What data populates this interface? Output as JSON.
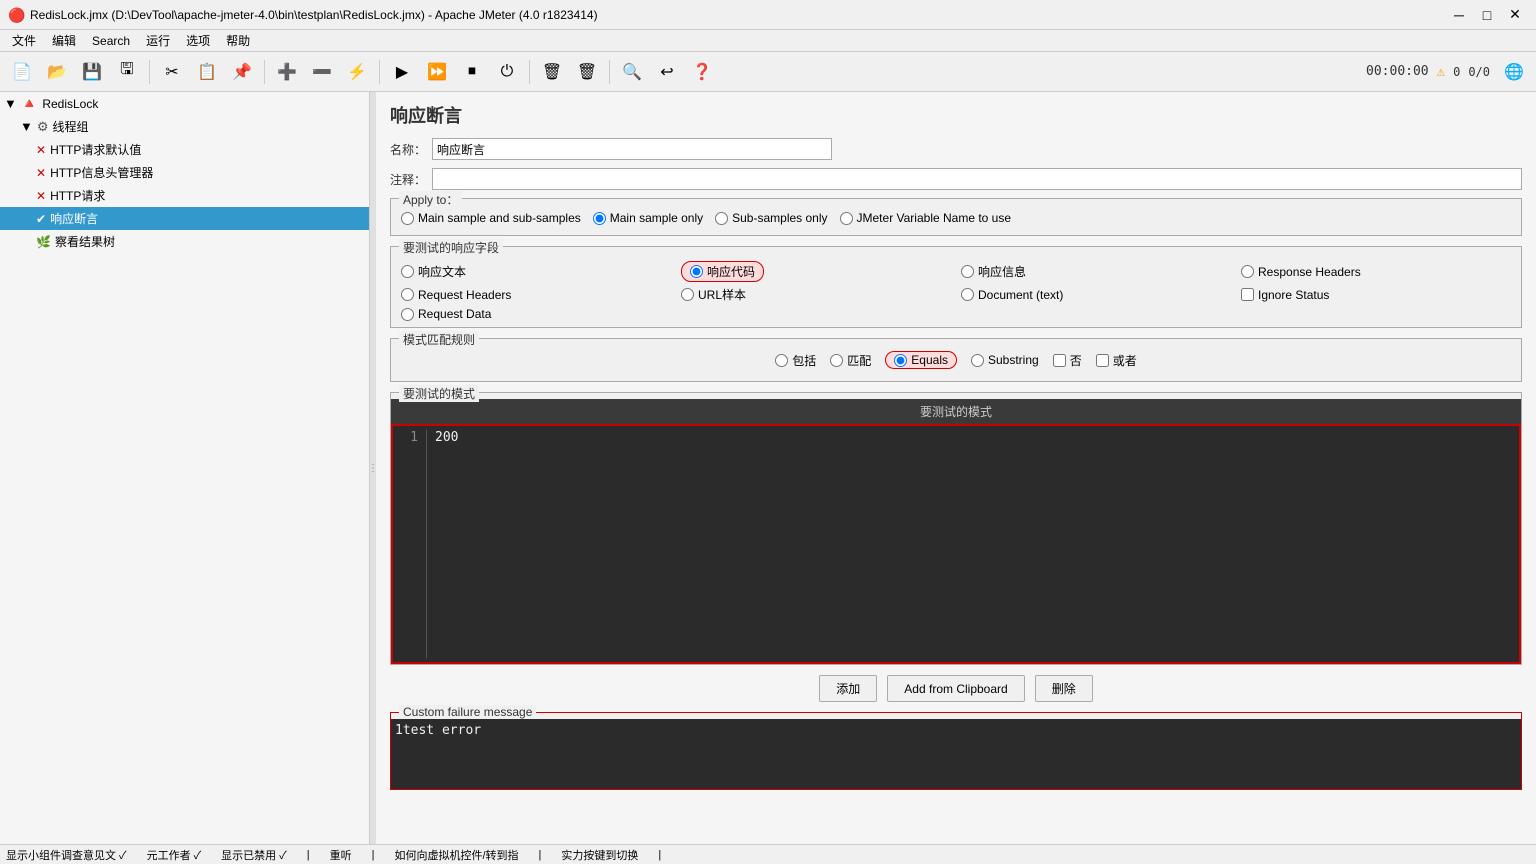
{
  "window": {
    "title": "RedisLock.jmx (D:\\DevTool\\apache-jmeter-4.0\\bin\\testplan\\RedisLock.jmx) - Apache JMeter (4.0 r1823414)"
  },
  "menubar": {
    "items": [
      "文件",
      "编辑",
      "Search",
      "运行",
      "选项",
      "帮助"
    ]
  },
  "toolbar": {
    "buttons": [
      {
        "name": "new",
        "icon": "📄"
      },
      {
        "name": "open",
        "icon": "📂"
      },
      {
        "name": "save",
        "icon": "💾"
      },
      {
        "name": "save-as",
        "icon": "🖫"
      },
      {
        "name": "cut",
        "icon": "✂"
      },
      {
        "name": "copy",
        "icon": "📋"
      },
      {
        "name": "paste",
        "icon": "📌"
      },
      {
        "name": "expand",
        "icon": "➕"
      },
      {
        "name": "collapse",
        "icon": "➖"
      },
      {
        "name": "toggle",
        "icon": "⚡"
      },
      {
        "name": "start",
        "icon": "▶"
      },
      {
        "name": "start-no-pause",
        "icon": "⏩"
      },
      {
        "name": "stop",
        "icon": "⏹"
      },
      {
        "name": "shutdown",
        "icon": "⏻"
      },
      {
        "name": "clear",
        "icon": "🗑"
      },
      {
        "name": "clear-all",
        "icon": "🗑"
      },
      {
        "name": "search",
        "icon": "🔍"
      },
      {
        "name": "undo",
        "icon": "↩"
      },
      {
        "name": "help",
        "icon": "❓"
      }
    ],
    "timer": "00:00:00",
    "warnings": "0",
    "errors": "0/0"
  },
  "sidebar": {
    "items": [
      {
        "id": "redislock",
        "label": "RedisLock",
        "level": 0,
        "icon": "🔺",
        "type": "test-plan"
      },
      {
        "id": "thread-group",
        "label": "线程组",
        "level": 1,
        "icon": "⚙",
        "type": "thread-group"
      },
      {
        "id": "http-defaults",
        "label": "HTTP请求默认值",
        "level": 2,
        "icon": "✕",
        "type": "config"
      },
      {
        "id": "http-header",
        "label": "HTTP信息头管理器",
        "level": 2,
        "icon": "✕",
        "type": "config"
      },
      {
        "id": "http-request",
        "label": "HTTP请求",
        "level": 2,
        "icon": "✕",
        "type": "sampler"
      },
      {
        "id": "response-assertion",
        "label": "响应断言",
        "level": 2,
        "icon": "✅",
        "type": "assertion",
        "selected": true
      },
      {
        "id": "view-results",
        "label": "察看结果树",
        "level": 2,
        "icon": "🌿",
        "type": "listener"
      }
    ]
  },
  "panel": {
    "title": "响应断言",
    "name_label": "名称：",
    "name_value": "响应断言",
    "comment_label": "注释：",
    "comment_value": "",
    "apply_to": {
      "legend": "Apply to：",
      "options": [
        {
          "label": "Main sample and sub-samples",
          "value": "main-sub",
          "checked": false
        },
        {
          "label": "Main sample only",
          "value": "main-only",
          "checked": true
        },
        {
          "label": "Sub-samples only",
          "value": "sub-only",
          "checked": false
        },
        {
          "label": "JMeter Variable Name to use",
          "value": "jmeter-var",
          "checked": false
        }
      ]
    },
    "fields": {
      "legend": "要测试的响应字段",
      "options": [
        {
          "label": "响应文本",
          "checked": false,
          "type": "radio"
        },
        {
          "label": "响应代码",
          "checked": true,
          "type": "radio",
          "highlighted": true
        },
        {
          "label": "响应信息",
          "checked": false,
          "type": "radio"
        },
        {
          "label": "Response Headers",
          "checked": false,
          "type": "radio"
        },
        {
          "label": "Request Headers",
          "checked": false,
          "type": "radio"
        },
        {
          "label": "URL样本",
          "checked": false,
          "type": "radio"
        },
        {
          "label": "Document (text)",
          "checked": false,
          "type": "radio"
        },
        {
          "label": "Ignore Status",
          "checked": false,
          "type": "checkbox"
        },
        {
          "label": "Request Data",
          "checked": false,
          "type": "radio"
        }
      ]
    },
    "pattern_rules": {
      "legend": "模式匹配规则",
      "options": [
        {
          "label": "包括",
          "value": "contains",
          "checked": false
        },
        {
          "label": "匹配",
          "value": "matches",
          "checked": false
        },
        {
          "label": "Equals",
          "value": "equals",
          "checked": true,
          "highlighted": true
        },
        {
          "label": "Substring",
          "value": "substring",
          "checked": false
        },
        {
          "label": "否",
          "value": "not",
          "checked": false
        },
        {
          "label": "或者",
          "value": "or",
          "checked": false
        }
      ]
    },
    "test_patterns": {
      "legend": "要测试的模式",
      "column_header": "要测试的模式",
      "rows": [
        {
          "num": 1,
          "value": "200"
        }
      ]
    },
    "buttons": {
      "add": "添加",
      "add_clipboard": "Add from Clipboard",
      "delete": "删除"
    },
    "custom_failure": {
      "legend": "Custom failure message",
      "rows": [
        {
          "num": 1,
          "value": "test error"
        }
      ]
    }
  },
  "statusbar": {
    "items": [
      "显示小组件调查意见文 ✓",
      "元工作者 ✓",
      "显示已禁用 ✓",
      "重听 |",
      "如何向虚拟机控件/转到指 |",
      "实力按键到切换 |"
    ]
  }
}
